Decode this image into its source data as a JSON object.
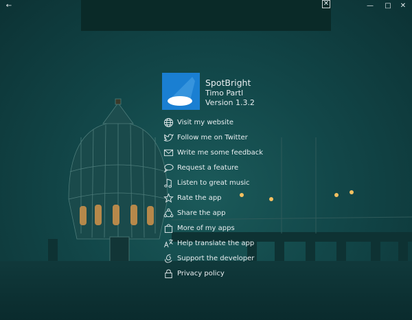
{
  "window": {
    "back_glyph": "←",
    "minimize_glyph": "—",
    "maximize_glyph": "□",
    "close_glyph": "✕",
    "ad_close_glyph": "✕"
  },
  "app": {
    "name": "SpotBright",
    "author": "Timo Partl",
    "version": "Version 1.3.2",
    "brand_color": "#1a7fd2"
  },
  "menu": {
    "items": [
      {
        "label": "Visit my website",
        "icon": "globe-icon"
      },
      {
        "label": "Follow me on Twitter",
        "icon": "twitter-icon"
      },
      {
        "label": "Write me some feedback",
        "icon": "mail-icon"
      },
      {
        "label": "Request a feature",
        "icon": "chat-bubble-icon"
      },
      {
        "label": "Listen to great music",
        "icon": "music-note-icon"
      },
      {
        "label": "Rate the app",
        "icon": "star-icon"
      },
      {
        "label": "Share the app",
        "icon": "share-icon"
      },
      {
        "label": "More of my apps",
        "icon": "shopping-bag-icon"
      },
      {
        "label": "Help translate the app",
        "icon": "translate-icon"
      },
      {
        "label": "Support the developer",
        "icon": "support-icon"
      },
      {
        "label": "Privacy policy",
        "icon": "lock-icon"
      }
    ]
  }
}
